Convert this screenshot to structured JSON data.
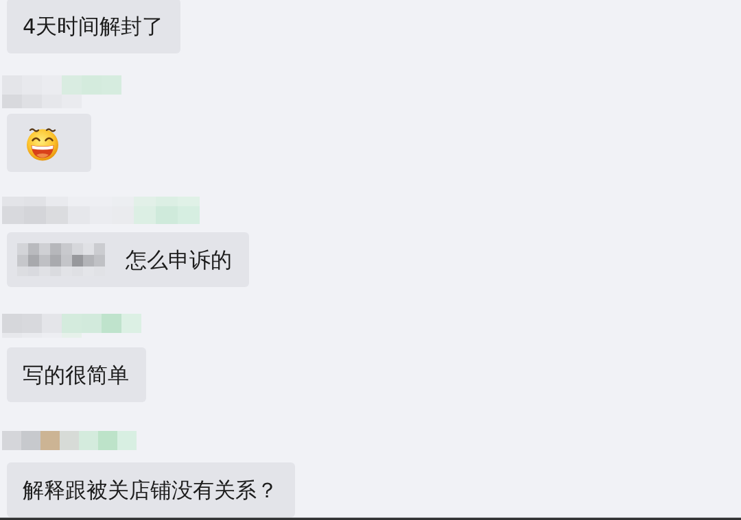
{
  "messages": [
    {
      "kind": "text",
      "sender_pixelated": false,
      "prefix_pixelated": false,
      "text": "4天时间解封了"
    },
    {
      "kind": "emoji",
      "sender_pixelated": true
    },
    {
      "kind": "text",
      "sender_pixelated": true,
      "prefix_pixelated": true,
      "text": "怎么申诉的"
    },
    {
      "kind": "text",
      "sender_pixelated": true,
      "prefix_pixelated": false,
      "text": "写的很简单"
    },
    {
      "kind": "text",
      "sender_pixelated": true,
      "prefix_pixelated": false,
      "text": "解释跟被关店铺没有关系？"
    }
  ]
}
